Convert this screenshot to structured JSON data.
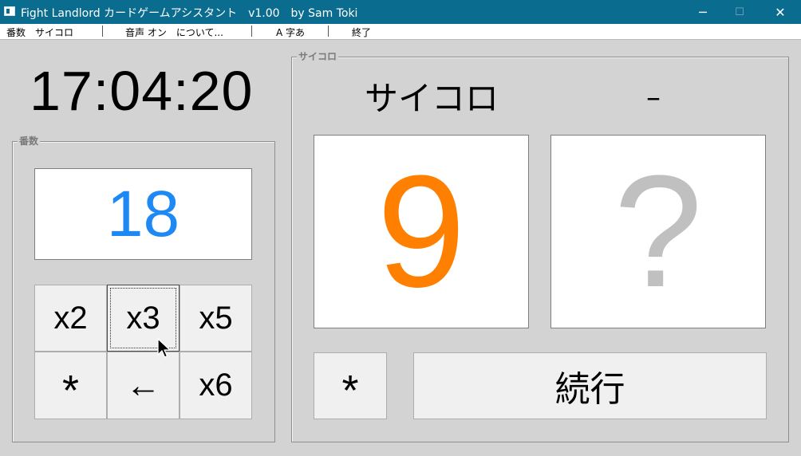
{
  "window": {
    "title": "Fight Landlord カードゲームアシスタント　v1.00　by Sam Toki",
    "minimize_glyph": "─",
    "maximize_glyph": "☐",
    "close_glyph": "✕"
  },
  "menu": {
    "items": [
      "番数　サイコロ",
      "音声 オン　について...",
      "A 字あ",
      "終了"
    ]
  },
  "clock": {
    "time": "17:04:20"
  },
  "score_group": {
    "label": "番数",
    "value": "18",
    "buttons": [
      "x2",
      "x3",
      "x5",
      "*",
      "←",
      "x6"
    ],
    "focused_button": "x3"
  },
  "dice_group": {
    "label": "サイコロ",
    "header_left": "サイコロ",
    "header_right": "–",
    "die1_value": "9",
    "die2_value": "?",
    "star_button": "*",
    "continue_button": "続行"
  },
  "colors": {
    "titlebar": "#0a6c8e",
    "score_value": "#1e88f5",
    "die1_value": "#ff7f00",
    "die2_value": "#c0c0c0"
  }
}
